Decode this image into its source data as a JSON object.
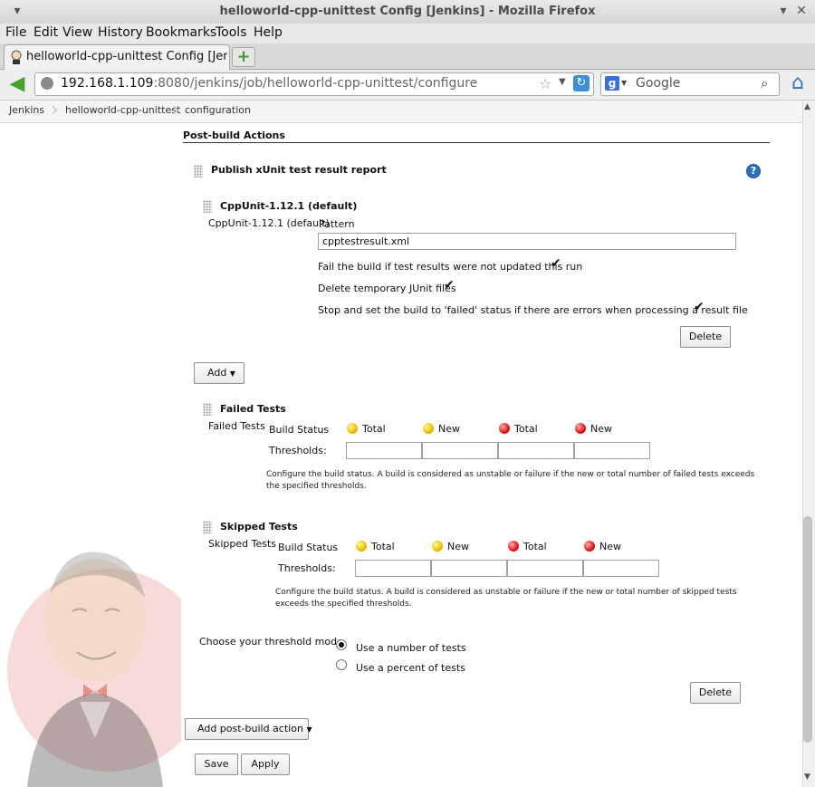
{
  "window": {
    "title": "helloworld-cpp-unittest Config [Jenkins] - Mozilla Firefox",
    "controls": [
      "▾",
      "✕"
    ]
  },
  "menu": [
    "File",
    "Edit",
    "View",
    "History",
    "Bookmarks",
    "Tools",
    "Help"
  ],
  "tab": {
    "label": "helloworld-cpp-unittest Config [Jenkins]",
    "new_tab": "+"
  },
  "nav": {
    "url_host": "192.168.1.109",
    "url_rest": ":8080/jenkins/job/helloworld-cpp-unittest/configure",
    "search_placeholder": "Google"
  },
  "breadcrumb": [
    "Jenkins",
    "helloworld-cpp-unittest",
    "configuration"
  ],
  "section": {
    "title": "Post-build Actions",
    "action": "Publish xUnit test result report",
    "help": "?"
  },
  "cppunit": {
    "header": "CppUnit-1.12.1 (default)",
    "label": "CppUnit-1.12.1 (default)",
    "pattern_label": "Pattern",
    "pattern_value": "cpptestresult.xml",
    "options": [
      {
        "label": "Fail the build if test results were not updated this run",
        "checked": true
      },
      {
        "label": "Delete temporary JUnit files",
        "checked": true
      },
      {
        "label": "Stop and set the build to 'failed' status if there are errors when processing a result file",
        "checked": true
      }
    ],
    "delete": "Delete"
  },
  "add_button": "Add",
  "failed": {
    "header": "Failed Tests",
    "label": "Failed Tests",
    "build_status": "Build Status",
    "thresholds": "Thresholds:",
    "cols": [
      "Total",
      "New",
      "Total",
      "New"
    ],
    "note": "Configure the build status. A build is considered as unstable or failure if the new or total number of failed tests exceeds the specified thresholds."
  },
  "skipped": {
    "header": "Skipped Tests",
    "label": "Skipped Tests",
    "build_status": "Build Status",
    "thresholds": "Thresholds:",
    "cols": [
      "Total",
      "New",
      "Total",
      "New"
    ],
    "note": "Configure the build status. A build is considered as unstable or failure if the new or total number of skipped tests exceeds the specified thresholds."
  },
  "threshold_mode": {
    "label": "Choose your threshold mode",
    "options": [
      {
        "label": "Use a number of tests",
        "selected": true
      },
      {
        "label": "Use a percent of tests",
        "selected": false
      }
    ]
  },
  "delete2": "Delete",
  "add_post_build": "Add post-build action",
  "save": "Save",
  "apply": "Apply",
  "colors": {
    "stable_yellow": "#f1c400",
    "failed_red": "#e41f1f"
  }
}
